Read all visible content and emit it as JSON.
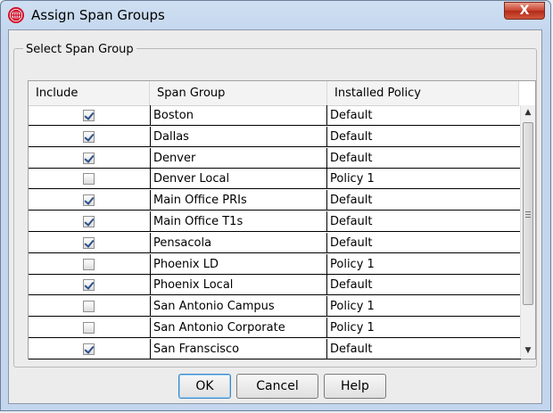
{
  "window": {
    "title": "Assign Span Groups",
    "close_label": "X"
  },
  "group": {
    "legend": "Select Span Group"
  },
  "table": {
    "columns": [
      "Include",
      "Span Group",
      "Installed Policy"
    ],
    "rows": [
      {
        "include": true,
        "group": "Boston",
        "policy": "Default"
      },
      {
        "include": true,
        "group": "Dallas",
        "policy": "Default"
      },
      {
        "include": true,
        "group": "Denver",
        "policy": "Default"
      },
      {
        "include": false,
        "group": "Denver Local",
        "policy": "Policy 1"
      },
      {
        "include": true,
        "group": "Main Office PRIs",
        "policy": "Default"
      },
      {
        "include": true,
        "group": "Main Office T1s",
        "policy": "Default"
      },
      {
        "include": true,
        "group": "Pensacola",
        "policy": "Default"
      },
      {
        "include": false,
        "group": "Phoenix LD",
        "policy": "Policy 1"
      },
      {
        "include": true,
        "group": "Phoenix Local",
        "policy": "Default"
      },
      {
        "include": false,
        "group": "San Antonio Campus",
        "policy": "Policy 1"
      },
      {
        "include": false,
        "group": "San Antonio Corporate",
        "policy": "Policy 1"
      },
      {
        "include": true,
        "group": "San Franscisco",
        "policy": "Default"
      }
    ]
  },
  "buttons": {
    "ok": "OK",
    "cancel": "Cancel",
    "help": "Help"
  },
  "icons": {
    "app": "globe-icon",
    "scroll_up": "chevron-up-icon",
    "scroll_down": "chevron-down-icon"
  },
  "colors": {
    "title_bar": "#c3d6ee",
    "close_button": "#c7422e",
    "app_icon": "#d0102a",
    "ok_focus": "#3a86c8"
  }
}
